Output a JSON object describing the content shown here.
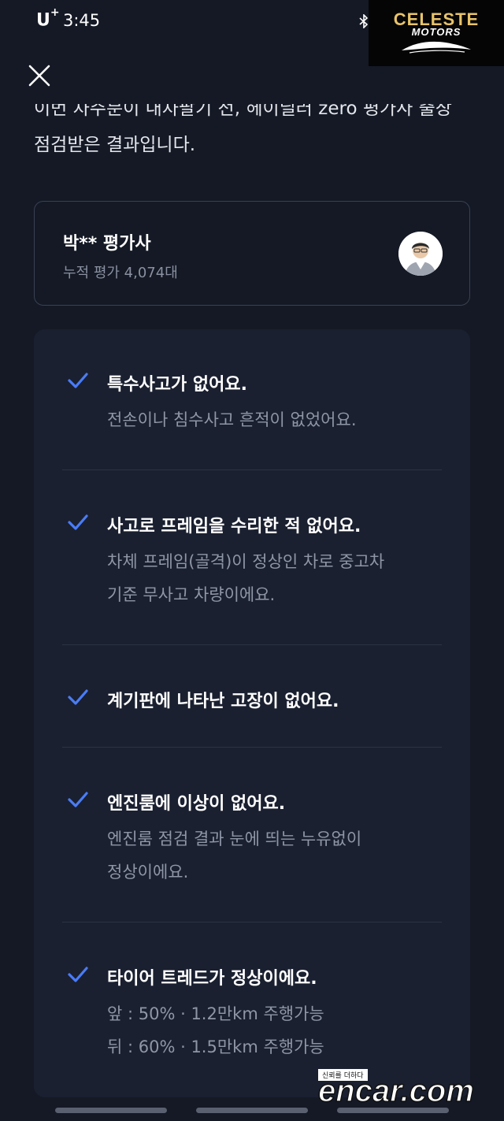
{
  "status_bar": {
    "carrier": "U",
    "carrier_plus": "+",
    "time": "3:45",
    "bluetooth_icon": "bluetooth-icon"
  },
  "logo": {
    "main": "CELESTE",
    "sub": "MOTORS"
  },
  "close_icon": "close-icon",
  "intro": {
    "line1": "이번 차주분이 내차팔기 전, 헤이딜러 zero 평가사 출장",
    "line2": "점검받은 결과입니다."
  },
  "evaluator": {
    "name": "박** 평가사",
    "count": "누적 평가 4,074대",
    "avatar_icon": "evaluator-avatar"
  },
  "checks": [
    {
      "title": "특수사고가 없어요.",
      "desc": [
        "전손이나 침수사고 흔적이 없었어요."
      ]
    },
    {
      "title": "사고로 프레임을 수리한 적 없어요.",
      "desc": [
        "차체 프레임(골격)이 정상인 차로 중고차",
        "기준 무사고 차량이에요."
      ]
    },
    {
      "title": "계기판에 나타난 고장이 없어요.",
      "desc": []
    },
    {
      "title": "엔진룸에 이상이 없어요.",
      "desc": [
        "엔진룸 점검 결과 눈에 띄는 누유없이",
        "정상이에요."
      ]
    },
    {
      "title": "타이어 트레드가 정상이에요.",
      "desc": [
        "앞 : 50% · 1.2만km 주행가능",
        "뒤 : 60% · 1.5만km 주행가능"
      ]
    }
  ],
  "watermark": {
    "tag": "신뢰를 더하다",
    "text": "encar.com"
  },
  "colors": {
    "background": "#141925",
    "card": "#1a2030",
    "check_accent": "#4a7cf6",
    "logo_gold": "#e8c36a"
  }
}
